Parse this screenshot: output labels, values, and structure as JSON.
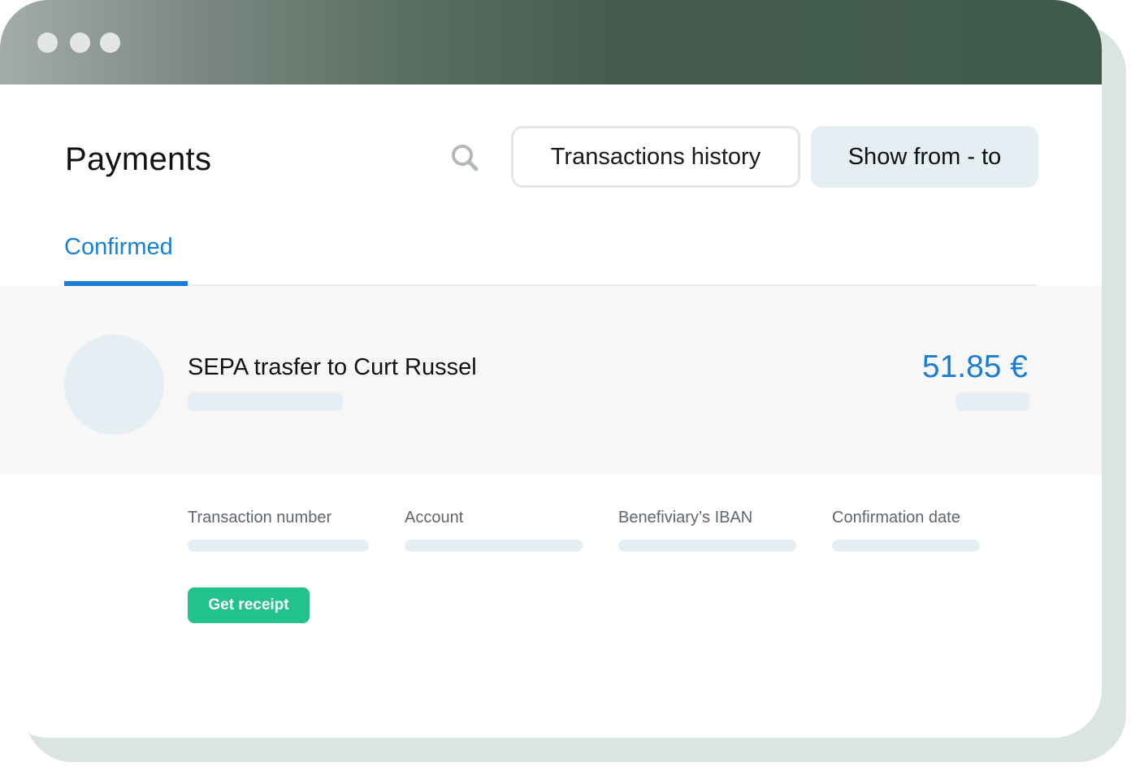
{
  "window": {
    "controls": [
      "window-dot",
      "window-dot",
      "window-dot"
    ]
  },
  "header": {
    "title": "Payments",
    "search_icon": "search-icon",
    "history_label": "Transactions history",
    "range_label": "Show from - to"
  },
  "tabs": [
    {
      "label": "Confirmed",
      "active": true
    }
  ],
  "payment": {
    "title": "SEPA trasfer to Curt Russel",
    "amount": "51.85 €",
    "details": [
      {
        "label": "Transaction number"
      },
      {
        "label": "Account"
      },
      {
        "label": "Benefiviary’s IBAN"
      },
      {
        "label": "Confirmation date"
      }
    ],
    "receipt_label": "Get receipt"
  },
  "colors": {
    "accent": "#1a7fd4",
    "receipt": "#22c38a",
    "skeleton": "#e4eef3",
    "titlebar_dark": "#3f5a4c"
  }
}
